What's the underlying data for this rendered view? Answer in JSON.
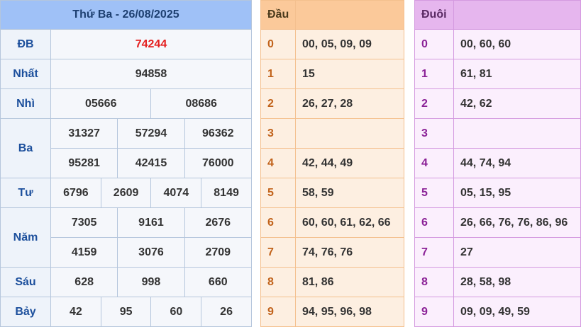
{
  "results": {
    "header": "Thứ Ba - 26/08/2025",
    "rows": [
      {
        "label": "ĐB",
        "numbers": [
          "74244"
        ]
      },
      {
        "label": "Nhất",
        "numbers": [
          "94858"
        ]
      },
      {
        "label": "Nhì",
        "numbers": [
          "05666",
          "08686"
        ]
      },
      {
        "label": "Ba",
        "numbers": [
          "31327",
          "57294",
          "96362",
          "95281",
          "42415",
          "76000"
        ]
      },
      {
        "label": "Tư",
        "numbers": [
          "6796",
          "2609",
          "4074",
          "8149"
        ]
      },
      {
        "label": "Năm",
        "numbers": [
          "7305",
          "9161",
          "2676",
          "4159",
          "3076",
          "2709"
        ]
      },
      {
        "label": "Sáu",
        "numbers": [
          "628",
          "998",
          "660"
        ]
      },
      {
        "label": "Bảy",
        "numbers": [
          "42",
          "95",
          "60",
          "26"
        ]
      }
    ]
  },
  "dau": {
    "header": "Đầu",
    "rows": [
      {
        "digit": "0",
        "values": "00, 05, 09, 09"
      },
      {
        "digit": "1",
        "values": "15"
      },
      {
        "digit": "2",
        "values": "26, 27, 28"
      },
      {
        "digit": "3",
        "values": ""
      },
      {
        "digit": "4",
        "values": "42, 44, 49"
      },
      {
        "digit": "5",
        "values": "58, 59"
      },
      {
        "digit": "6",
        "values": "60, 60, 61, 62, 66"
      },
      {
        "digit": "7",
        "values": "74, 76, 76"
      },
      {
        "digit": "8",
        "values": "81, 86"
      },
      {
        "digit": "9",
        "values": "94, 95, 96, 98"
      }
    ]
  },
  "duoi": {
    "header": "Đuôi",
    "rows": [
      {
        "digit": "0",
        "values": "00, 60, 60"
      },
      {
        "digit": "1",
        "values": "61, 81"
      },
      {
        "digit": "2",
        "values": "42, 62"
      },
      {
        "digit": "3",
        "values": ""
      },
      {
        "digit": "4",
        "values": "44, 74, 94"
      },
      {
        "digit": "5",
        "values": "05, 15, 95"
      },
      {
        "digit": "6",
        "values": "26, 66, 76, 76, 86, 96"
      },
      {
        "digit": "7",
        "values": "27"
      },
      {
        "digit": "8",
        "values": "28, 58, 98"
      },
      {
        "digit": "9",
        "values": "09, 09, 49, 59"
      }
    ]
  },
  "colors": {
    "special_prize": "#e41e1e",
    "results_header": "#9fc1f7",
    "dau_header": "#fbc99a",
    "duoi_header": "#e6b6ee"
  }
}
